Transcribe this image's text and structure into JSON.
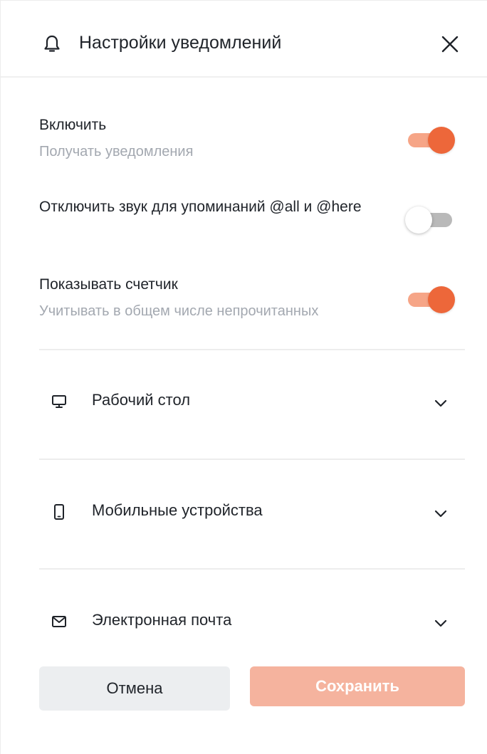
{
  "header": {
    "title": "Настройки уведомлений",
    "bell_icon": "bell-icon",
    "close_icon": "close-icon"
  },
  "settings": [
    {
      "label": "Включить",
      "description": "Получать уведомления",
      "enabled": true
    },
    {
      "label": "Отключить звук для упоминаний @all и @here",
      "description": "",
      "enabled": false
    },
    {
      "label": "Показывать счетчик",
      "description": "Учитывать в общем числе непрочитанных",
      "enabled": true
    }
  ],
  "sections": [
    {
      "label": "Рабочий стол",
      "icon": "monitor-icon",
      "expanded": false
    },
    {
      "label": "Мобильные устройства",
      "icon": "mobile-icon",
      "expanded": false
    },
    {
      "label": "Электронная почта",
      "icon": "mail-icon",
      "expanded": false
    }
  ],
  "actions": {
    "cancel_label": "Отмена",
    "save_label": "Сохранить"
  },
  "colors": {
    "accent": "#ed673a",
    "accent_track": "#f6a587",
    "save_button": "#f5b39e",
    "muted_text": "#a3a8b0"
  }
}
